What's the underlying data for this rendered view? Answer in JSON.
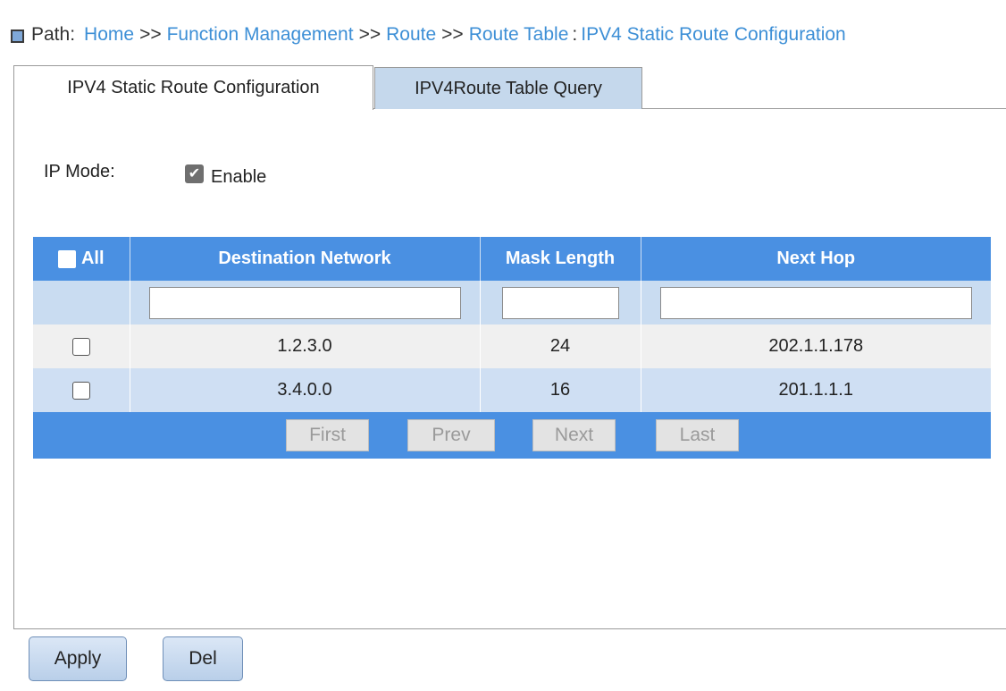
{
  "breadcrumb": {
    "label": "Path:",
    "items": [
      "Home",
      "Function Management",
      "Route",
      "Route Table"
    ],
    "separator": ">>",
    "current_sep": ":",
    "current": "IPV4 Static Route Configuration"
  },
  "tabs": [
    {
      "label": "IPV4 Static Route Configuration",
      "active": true
    },
    {
      "label": "IPV4Route Table Query",
      "active": false
    }
  ],
  "ip_mode": {
    "label": "IP Mode:",
    "checkbox_label": "Enable",
    "checked": true
  },
  "table": {
    "headers": [
      "All",
      "Destination Network",
      "Mask Length",
      "Next Hop"
    ],
    "rows": [
      {
        "destination": "1.2.3.0",
        "mask": "24",
        "next_hop": "202.1.1.178"
      },
      {
        "destination": "3.4.0.0",
        "mask": "16",
        "next_hop": "201.1.1.1"
      }
    ]
  },
  "pager": {
    "first": "First",
    "prev": "Prev",
    "next": "Next",
    "last": "Last"
  },
  "actions": {
    "apply": "Apply",
    "del": "Del"
  },
  "colors": {
    "header_blue": "#4a90e2",
    "link_blue": "#3d8fd6",
    "row_blue": "#cfdff3",
    "tab_inactive": "#c5d8ec"
  }
}
